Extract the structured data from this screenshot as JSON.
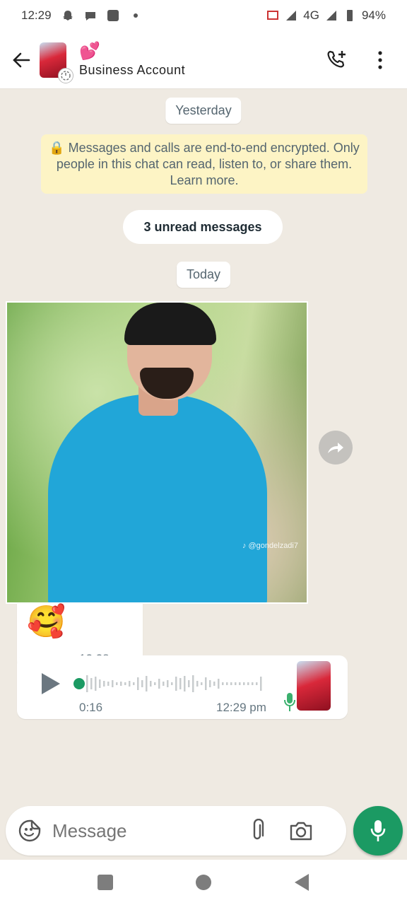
{
  "status_bar": {
    "time": "12:29",
    "network": "4G",
    "battery": "94%",
    "icons": [
      "snapchat-icon",
      "chat-bubble-icon",
      "app-icon",
      "dot-icon",
      "cast-icon",
      "signal-icon",
      "battery-icon"
    ]
  },
  "header": {
    "title_emoji": "💕",
    "account_name": "Business Account",
    "actions": [
      "add-call-icon",
      "more-options-icon"
    ]
  },
  "chat": {
    "day_yesterday": "Yesterday",
    "encryption_note": "🔒 Messages and calls are end-to-end encrypted. Only people in this chat can read, listen to, or share them. Learn more.",
    "unread_label": "3 unread messages",
    "day_today": "Today",
    "image_watermark": "♪ @gondelzadi7",
    "emoji_message": {
      "emoji": "🥰",
      "time": "12:28 pm"
    },
    "voice_message": {
      "duration": "0:16",
      "time": "12:29 pm",
      "progress": 0
    }
  },
  "input": {
    "placeholder": "Message"
  },
  "colors": {
    "accent_green": "#1b9a63",
    "chat_bg": "#efeae2",
    "encryption_bg": "#fdf4c5"
  }
}
